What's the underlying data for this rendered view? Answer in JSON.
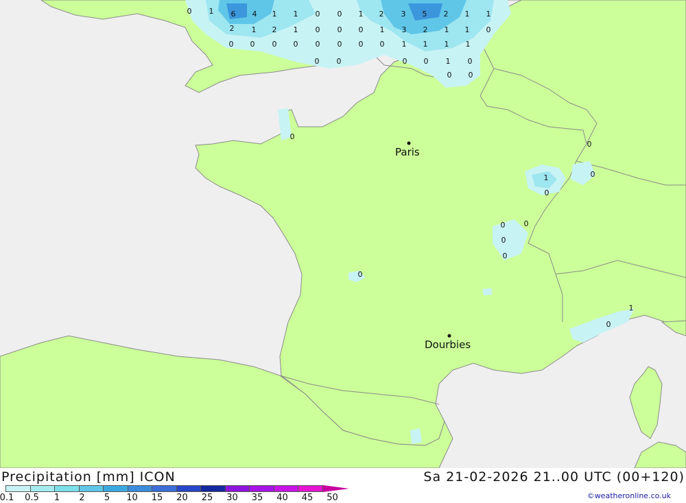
{
  "map": {
    "cities": [
      {
        "name": "Paris"
      },
      {
        "name": "Dourbies"
      }
    ],
    "precip_values": [
      "0",
      "1",
      "6",
      "4",
      "1",
      "1",
      "0",
      "0",
      "1",
      "2",
      "3",
      "5",
      "2",
      "1",
      "1",
      "2",
      "1",
      "2",
      "1",
      "0",
      "0",
      "0",
      "1",
      "3",
      "2",
      "1",
      "1",
      "0",
      "0",
      "0",
      "0",
      "0",
      "0",
      "0",
      "0",
      "0",
      "1",
      "1",
      "1",
      "1",
      "0",
      "0",
      "0",
      "0",
      "1",
      "0",
      "0",
      "0",
      "0",
      "0",
      "1",
      "0",
      "0",
      "0",
      "0",
      "0",
      "0",
      "0",
      "0",
      "1",
      "0"
    ],
    "colors": {
      "sea": "#efefef",
      "land": "#ccff99",
      "border": "#7a7a7a",
      "precip_light": "#c8f3f5",
      "precip_medium": "#9ee6f0",
      "precip_heavy": "#5fc6e8",
      "precip_max": "#3c96dc"
    }
  },
  "footer": {
    "title": "Precipitation [mm] ICON",
    "datetime": "Sa 21-02-2026 21..00 UTC (00+120)",
    "credit": "©weatheronline.co.uk"
  },
  "legend": {
    "ticks": [
      "0.1",
      "0.5",
      "1",
      "2",
      "5",
      "10",
      "15",
      "20",
      "25",
      "30",
      "35",
      "40",
      "45",
      "50"
    ],
    "colors": [
      "#c8f3f5",
      "#a4ecf0",
      "#7ddfea",
      "#5fc6e8",
      "#3caae0",
      "#3c8cdc",
      "#3c6ed8",
      "#2846c8",
      "#1428a0",
      "#8c14dc",
      "#a614e6",
      "#c814e6",
      "#e614d2",
      "#c800a0"
    ]
  }
}
